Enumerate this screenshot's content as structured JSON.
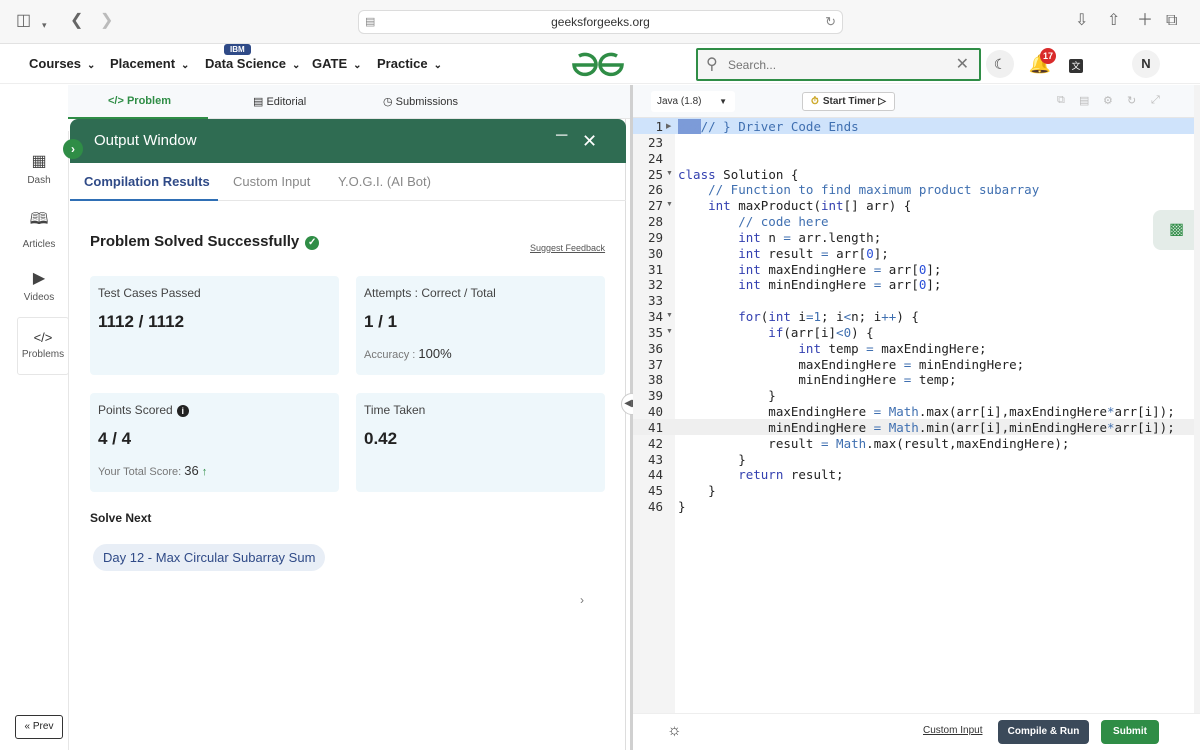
{
  "browser": {
    "url": "geeksforgeeks.org"
  },
  "nav": {
    "items": [
      {
        "label": "Courses"
      },
      {
        "label": "Placement"
      },
      {
        "label": "Data Science"
      },
      {
        "label": "GATE"
      },
      {
        "label": "Practice"
      }
    ],
    "ibm_badge": "IBM",
    "search_placeholder": "Search...",
    "notification_count": "17",
    "avatar_initial": "N"
  },
  "problem_tabs": [
    {
      "label": "Problem"
    },
    {
      "label": "Editorial"
    },
    {
      "label": "Submissions"
    }
  ],
  "sidebar": {
    "items": [
      {
        "label": "Dash"
      },
      {
        "label": "Articles"
      },
      {
        "label": "Videos"
      },
      {
        "label": "Problems"
      }
    ],
    "prev_label": "Prev"
  },
  "output": {
    "title": "Output Window",
    "tabs": [
      {
        "label": "Compilation Results"
      },
      {
        "label": "Custom Input"
      },
      {
        "label": "Y.O.G.I. (AI Bot)"
      }
    ],
    "status": "Problem Solved Successfully",
    "suggest_feedback": "Suggest Feedback",
    "test_cases_label": "Test Cases Passed",
    "test_cases_value": "1112 / 1112",
    "attempts_label": "Attempts : Correct / Total",
    "attempts_value": "1 / 1",
    "accuracy_label": "Accuracy :",
    "accuracy_value": "100%",
    "points_label": "Points Scored",
    "points_value": "4 / 4",
    "total_score_label": "Your Total Score:",
    "total_score_value": "36",
    "time_label": "Time Taken",
    "time_value": "0.42",
    "solve_next_label": "Solve Next",
    "next_problem": "Day 12 - Max Circular Subarray Sum"
  },
  "editor": {
    "language": "Java (1.8)",
    "timer_label": "Start Timer",
    "custom_input_link": "Custom Input",
    "compile_label": "Compile & Run",
    "submit_label": "Submit",
    "line_numbers": [
      "1",
      "23",
      "24",
      "25",
      "26",
      "27",
      "28",
      "29",
      "30",
      "31",
      "32",
      "33",
      "34",
      "35",
      "36",
      "37",
      "38",
      "39",
      "40",
      "41",
      "42",
      "43",
      "44",
      "45",
      "46"
    ],
    "code": {
      "l1": "// } Driver Code Ends",
      "l25a": "class",
      "l25b": " Solution {",
      "l26": "    // Function to find maximum product subarray",
      "l27a": "    int",
      "l27b": " maxProduct(",
      "l27c": "int",
      "l27d": "[] arr) {",
      "l28": "        // code here",
      "l29a": "        int",
      "l29b": " n ",
      "l29c": "=",
      "l29d": " arr.length;",
      "l30a": "        int",
      "l30b": " result ",
      "l30c": "=",
      "l30d": " arr[",
      "l30e": "0",
      "l30f": "];",
      "l31a": "        int",
      "l31b": " maxEndingHere ",
      "l31c": "=",
      "l31d": " arr[",
      "l31e": "0",
      "l31f": "];",
      "l32a": "        int",
      "l32b": " minEndingHere ",
      "l32c": "=",
      "l32d": " arr[",
      "l32e": "0",
      "l32f": "];",
      "l34a": "        for",
      "l34b": "(",
      "l34c": "int",
      "l34d": " i",
      "l34e": "=1",
      "l34f": "; i",
      "l34g": "<",
      "l34h": "n; i",
      "l34i": "++",
      "l34j": ") {",
      "l35a": "            if",
      "l35b": "(arr[i]",
      "l35c": "<0",
      "l35d": ") {",
      "l36a": "                int",
      "l36b": " temp ",
      "l36c": "=",
      "l36d": " maxEndingHere;",
      "l37a": "                maxEndingHere ",
      "l37b": "=",
      "l37c": " minEndingHere;",
      "l38a": "                minEndingHere ",
      "l38b": "=",
      "l38c": " temp;",
      "l39": "            }",
      "l40a": "            maxEndingHere ",
      "l40b": "=",
      "l40c": " Math",
      "l40d": ".max(arr[i],maxEndingHere",
      "l40e": "*",
      "l40f": "arr[i]);",
      "l41a": "            minEndingHere ",
      "l41b": "=",
      "l41c": " Math",
      "l41d": ".min(arr[i],minEndingHere",
      "l41e": "*",
      "l41f": "arr[i]);",
      "l42a": "            result ",
      "l42b": "=",
      "l42c": " Math",
      "l42d": ".max(result,maxEndingHere);",
      "l43": "        }",
      "l44a": "        return",
      "l44b": " result;",
      "l45": "    }",
      "l46": "}"
    }
  },
  "colors": {
    "brand_green": "#2f8d46",
    "output_header": "#2f6c52",
    "link_blue": "#2f4a87"
  }
}
